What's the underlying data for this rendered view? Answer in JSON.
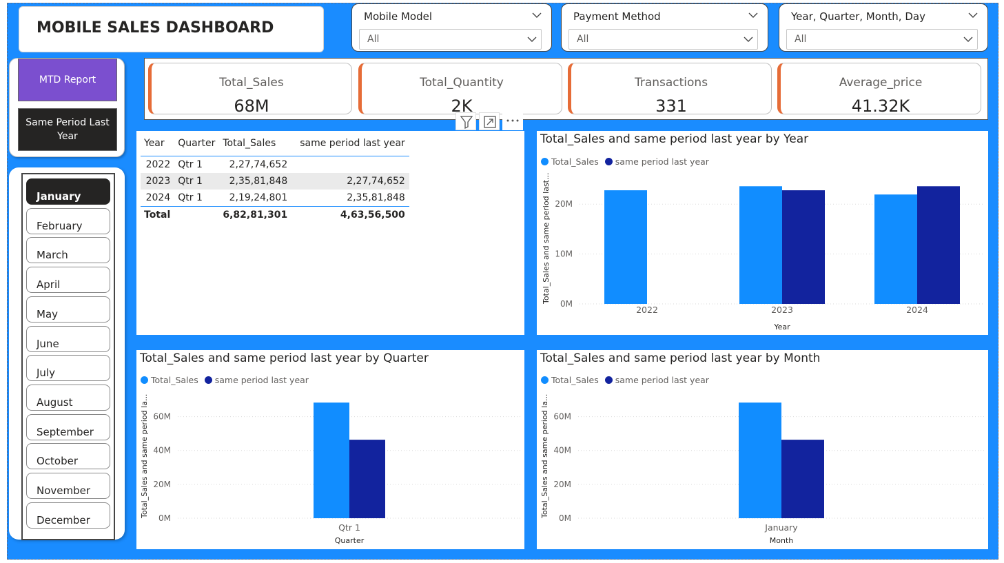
{
  "title": "MOBILE SALES DASHBOARD",
  "slicers": [
    {
      "header": "Mobile Model",
      "value": "All"
    },
    {
      "header": "Payment Method",
      "value": "All"
    },
    {
      "header": "Year, Quarter, Month, Day",
      "value": "All"
    }
  ],
  "nav": {
    "mtd_label": "MTD Report",
    "spl_label": "Same Period Last Year"
  },
  "months": [
    "January",
    "February",
    "March",
    "April",
    "May",
    "June",
    "July",
    "August",
    "September",
    "October",
    "November",
    "December"
  ],
  "selected_month": "January",
  "kpis": [
    {
      "label": "Total_Sales",
      "value": "68M"
    },
    {
      "label": "Total_Quantity",
      "value": "2K"
    },
    {
      "label": "Transactions",
      "value": "331"
    },
    {
      "label": "Average_price",
      "value": "41.32K"
    }
  ],
  "table": {
    "headers": [
      "Year",
      "Quarter",
      "Total_Sales",
      "same period last year"
    ],
    "rows": [
      [
        "2022",
        "Qtr 1",
        "2,27,74,652",
        ""
      ],
      [
        "2023",
        "Qtr 1",
        "2,35,81,848",
        "2,27,74,652"
      ],
      [
        "2024",
        "Qtr 1",
        "2,19,24,801",
        "2,35,81,848"
      ]
    ],
    "total": [
      "Total",
      "",
      "6,82,81,301",
      "4,63,56,500"
    ]
  },
  "legend": {
    "series1": "Total_Sales",
    "series2": "same period last year"
  },
  "colors": {
    "series1": "#118dff",
    "series2": "#12239e",
    "accent": "#e66c37",
    "canvas": "#1a8cff",
    "mtd": "#7b4fcf"
  },
  "chart_data": [
    {
      "type": "bar",
      "title": "Total_Sales and same period last year by Year",
      "xlabel": "Year",
      "ylabel": "Total_Sales and same period last...",
      "categories": [
        "2022",
        "2023",
        "2024"
      ],
      "series": [
        {
          "name": "Total_Sales",
          "values": [
            22774652,
            23581848,
            21924801
          ]
        },
        {
          "name": "same period last year",
          "values": [
            0,
            22774652,
            23581848
          ]
        }
      ],
      "yticks": [
        "0M",
        "10M",
        "20M"
      ],
      "ylim": [
        0,
        25000000
      ]
    },
    {
      "type": "bar",
      "title": "Total_Sales and same period last year by Quarter",
      "xlabel": "Quarter",
      "ylabel": "Total_Sales and same period la...",
      "categories": [
        "Qtr 1"
      ],
      "series": [
        {
          "name": "Total_Sales",
          "values": [
            68281301
          ]
        },
        {
          "name": "same period last year",
          "values": [
            46356500
          ]
        }
      ],
      "yticks": [
        "0M",
        "20M",
        "40M",
        "60M"
      ],
      "ylim": [
        0,
        70000000
      ]
    },
    {
      "type": "bar",
      "title": "Total_Sales and same period last year by Month",
      "xlabel": "Month",
      "ylabel": "Total_Sales and same period la...",
      "categories": [
        "January"
      ],
      "series": [
        {
          "name": "Total_Sales",
          "values": [
            68281301
          ]
        },
        {
          "name": "same period last year",
          "values": [
            46356500
          ]
        }
      ],
      "yticks": [
        "0M",
        "20M",
        "40M",
        "60M"
      ],
      "ylim": [
        0,
        70000000
      ]
    }
  ]
}
